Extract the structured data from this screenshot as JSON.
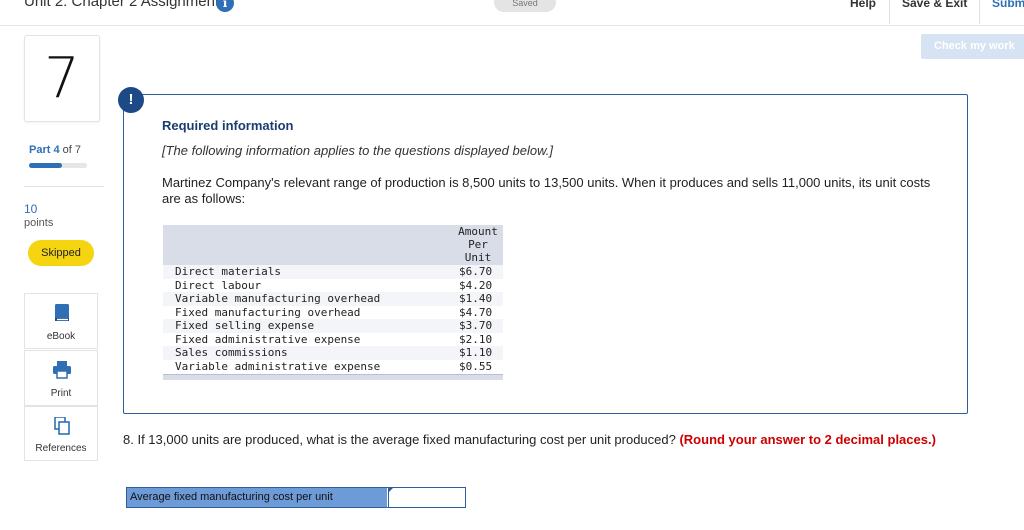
{
  "header": {
    "assignment_title": "Unit 2: Chapter 2 Assignment",
    "info_icon": "i",
    "save_status": "Saved",
    "help_label": "Help",
    "save_exit_label": "Save & Exit",
    "submit_label": "Subm"
  },
  "check_button": {
    "label": "Check my work"
  },
  "rail": {
    "question_number": "7",
    "part_label": "Part 4",
    "part_total": "of 7",
    "part_progress": 0.57,
    "points_value": "10",
    "points_label": "points",
    "status_badge": "Skipped",
    "tools": [
      {
        "label": "eBook",
        "icon": "book-icon"
      },
      {
        "label": "Print",
        "icon": "printer-icon"
      },
      {
        "label": "References",
        "icon": "copy-icon"
      }
    ]
  },
  "required_info": {
    "alert_icon": "!",
    "title": "Required information",
    "note": "[The following information applies to the questions displayed below.]",
    "body": "Martinez Company's relevant range of production is 8,500 units to 13,500 units. When it produces and sells 11,000 units, its unit costs are as follows:",
    "table": {
      "header": [
        "Amount",
        "Per",
        "Unit"
      ],
      "rows": [
        {
          "item": "Direct materials",
          "value": "$6.70"
        },
        {
          "item": "Direct labour",
          "value": "$4.20"
        },
        {
          "item": "Variable manufacturing overhead",
          "value": "$1.40"
        },
        {
          "item": "Fixed manufacturing overhead",
          "value": "$4.70"
        },
        {
          "item": "Fixed selling expense",
          "value": "$3.70"
        },
        {
          "item": "Fixed administrative expense",
          "value": "$2.10"
        },
        {
          "item": "Sales commissions",
          "value": "$1.10"
        },
        {
          "item": "Variable administrative expense",
          "value": "$0.55"
        }
      ]
    }
  },
  "question": {
    "text": "8. If 13,000 units are produced, what is the average fixed manufacturing cost per unit produced?",
    "hint": "(Round your answer to 2 decimal places.)",
    "answer_label": "Average fixed manufacturing cost per unit",
    "answer_value": ""
  }
}
